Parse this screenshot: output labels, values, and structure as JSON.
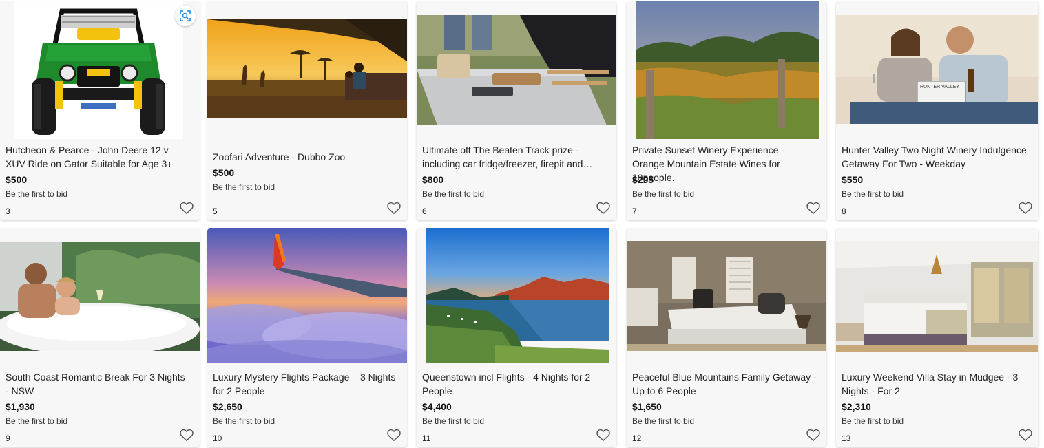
{
  "listings": [
    {
      "title": "Hutcheon & Pearce - John Deere 12 v XUV Ride on Gator Suitable for Age 3+",
      "price": "$500",
      "bid_status": "Be the first to bid",
      "lot": "3"
    },
    {
      "title": "Zoofari Adventure - Dubbo Zoo",
      "price": "$500",
      "bid_status": "Be the first to bid",
      "lot": "5"
    },
    {
      "title": "Ultimate off The Beaten Track prize - including car fridge/freezer, firepit and…",
      "price": "$800",
      "bid_status": "Be the first to bid",
      "lot": "6"
    },
    {
      "title": "Private Sunset Winery Experience - Orange Mountain Estate Wines for 10people.",
      "price": "$295",
      "bid_status": "Be the first to bid",
      "lot": "7"
    },
    {
      "title": "Hunter Valley Two Night Winery Indulgence Getaway For Two - Weekday",
      "price": "$550",
      "bid_status": "Be the first to bid",
      "lot": "8"
    },
    {
      "title": "South Coast Romantic Break For 3 Nights - NSW",
      "price": "$1,930",
      "bid_status": "Be the first to bid",
      "lot": "9"
    },
    {
      "title": "Luxury Mystery Flights Package – 3 Nights for 2 People",
      "price": "$2,650",
      "bid_status": "Be the first to bid",
      "lot": "10"
    },
    {
      "title": "Queenstown incl Flights - 4 Nights for 2 People",
      "price": "$4,400",
      "bid_status": "Be the first to bid",
      "lot": "11"
    },
    {
      "title": "Peaceful Blue Mountains Family Getaway - Up to 6 People",
      "price": "$1,650",
      "bid_status": "Be the first to bid",
      "lot": "12"
    },
    {
      "title": "Luxury Weekend Villa Stay in Mudgee - 3 Nights - For 2",
      "price": "$2,310",
      "bid_status": "Be the first to bid",
      "lot": "13"
    }
  ],
  "book_text": "HUNTER VALLEY",
  "icons": {
    "watch": "heart-outline-icon",
    "visual_search": "image-search-icon"
  },
  "colors": {
    "card_bg": "#f7f7f7",
    "icon_grey": "#555555",
    "lens_blue": "#1e88e5"
  }
}
